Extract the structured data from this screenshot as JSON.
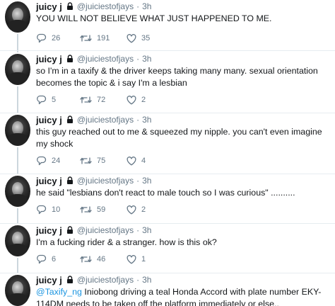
{
  "author": {
    "name": "juicy j",
    "handle": "@juiciestofjays",
    "separator": "·",
    "time": "3h"
  },
  "tweets": [
    {
      "text": "YOU WILL NOT BELIEVE WHAT JUST HAPPENED TO ME.",
      "replies": "26",
      "retweets": "191",
      "likes": "35"
    },
    {
      "text": "so I'm in a taxify & the driver keeps taking many many. sexual orientation becomes the topic & i say I'm a lesbian",
      "replies": "5",
      "retweets": "72",
      "likes": "2"
    },
    {
      "text": "this guy reached out to me & squeezed my nipple. you can't even imagine my shock",
      "replies": "24",
      "retweets": "75",
      "likes": "4"
    },
    {
      "text": "he said \"lesbians don't react to male touch so I was curious\" ..........",
      "replies": "10",
      "retweets": "59",
      "likes": "2"
    },
    {
      "text": "I'm a fucking rider & a stranger. how is this ok?",
      "replies": "6",
      "retweets": "46",
      "likes": "1"
    },
    {
      "mention": "@Taxify_ng",
      "text": " Iniobong driving a teal Honda Accord with plate number EKY-114DM needs to be taken off the platform immediately or else.."
    }
  ],
  "icons": {
    "reply": "reply-icon",
    "retweet": "retweet-icon",
    "like": "heart-icon",
    "verified_badge": "lock-icon"
  },
  "colors": {
    "text": "#14171a",
    "muted": "#657786",
    "link": "#1b95e0",
    "thread_line": "#ccd6dd",
    "divider": "#e6ecf0"
  }
}
